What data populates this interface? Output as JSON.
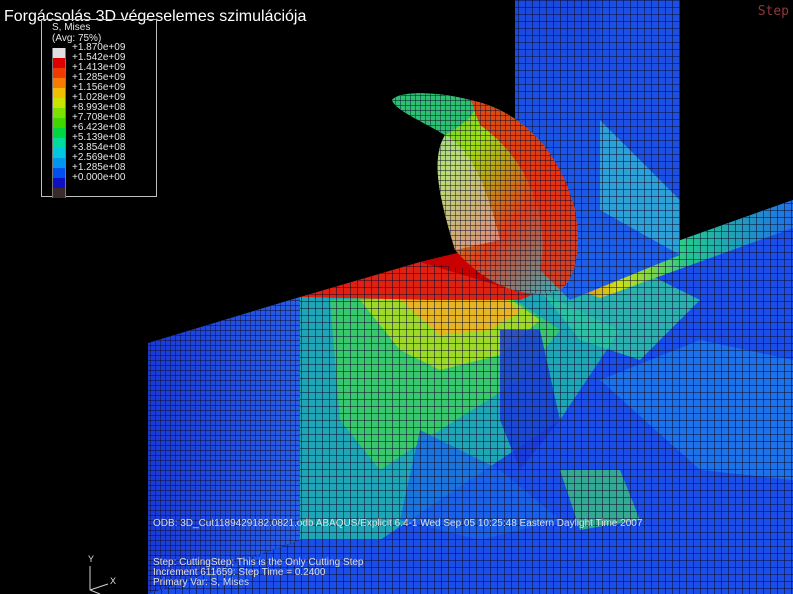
{
  "video": {
    "title": "Forgácsolás 3D végeselemes szimulációja"
  },
  "viewport": {
    "step_label": "Step"
  },
  "legend": {
    "variable": "S, Mises",
    "averaging": "(Avg: 75%)",
    "entries": [
      {
        "value": "+1.870e+09",
        "color": "#e0e0e0"
      },
      {
        "value": "+1.542e+09",
        "color": "#e00000"
      },
      {
        "value": "+1.413e+09",
        "color": "#ef3b00"
      },
      {
        "value": "+1.285e+09",
        "color": "#f87a00"
      },
      {
        "value": "+1.156e+09",
        "color": "#f0c000"
      },
      {
        "value": "+1.028e+09",
        "color": "#c8e400"
      },
      {
        "value": "+8.993e+08",
        "color": "#7ee000"
      },
      {
        "value": "+7.708e+08",
        "color": "#3ed800"
      },
      {
        "value": "+6.423e+08",
        "color": "#00d640"
      },
      {
        "value": "+5.139e+08",
        "color": "#00dca0"
      },
      {
        "value": "+3.854e+08",
        "color": "#00c8e0"
      },
      {
        "value": "+2.569e+08",
        "color": "#0096f0"
      },
      {
        "value": "+1.285e+08",
        "color": "#0050f0"
      },
      {
        "value": "+0.000e+00",
        "color": "#1010c0"
      }
    ],
    "bottom_swatch_color": "#3a2a2a"
  },
  "status": {
    "odb_line": "ODB: 3D_Cut1189429182.0821.odb    ABAQUS/Explicit 6.4-1    Wed Sep 05 10:25:48 Eastern Daylight Time 2007",
    "step_line": "Step: CuttingStep; This is the Only Cutting Step",
    "increment_line": "Increment  611659: Step Time =  0.2400",
    "primary_var_line": "Primary Var: S, Mises"
  },
  "triad": {
    "y_label": "Y",
    "x_label": "X"
  },
  "colors": {
    "background": "#000000",
    "mesh_line": "#0b0b2a"
  }
}
